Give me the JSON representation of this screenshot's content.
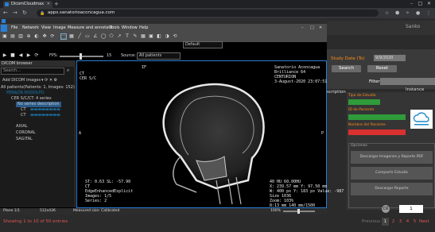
{
  "browser": {
    "tab_title": "DicomCloudmax",
    "url": "apps.sanatorioaconcagua.com"
  },
  "webpage": {
    "user": "Sanko",
    "study_date_label": "Study Date (To)",
    "study_date_value": "9/9/2020",
    "search_button": "Search",
    "reset_button": "Reset",
    "filter_label": "Filter:",
    "column_description": "scription",
    "column_instance": "Instance",
    "patient": {
      "tipo_estudio_label": "Tipo de Estudio",
      "id_paciente_label": "ID de Paciente",
      "nombre_label": "Nombre del Paciente"
    },
    "opciones_label": "Opciones",
    "options": [
      "Descargar Imagenes y Reporte PDF",
      "Compartir Estudio",
      "Descargar Reporte"
    ],
    "showing": "Showing 1 to 10 of 50 entries",
    "pager": {
      "prev": "Previous",
      "pages": [
        "1",
        "2",
        "3",
        "4",
        "5"
      ],
      "next": "Next"
    },
    "cr_badge": "CR",
    "page_number": "1"
  },
  "dicom": {
    "app_title": "DicomMax",
    "menu": [
      "File",
      "Network",
      "View",
      "Image",
      "Measure and annotate",
      "Tools",
      "Window",
      "Help"
    ],
    "layout_select": "Default",
    "fps_label": "FPS:",
    "fps_value": "15",
    "source_label": "Source:",
    "source_value": "All patients",
    "browser_title": "DICOM browser",
    "search_placeholder": "Search...",
    "add_images": "Add DICOM images",
    "tree": [
      "All patients(Patients: 1, Images: 152)",
      "PERALTA RODOLFO",
      "CER S/C/CT: 4 series",
      "No series description",
      "CT",
      "CT",
      "AXIAL",
      "CORONAL",
      "SAGITAL"
    ],
    "overlay": {
      "top_left": "CT\nCER S/C",
      "top_center": "IF",
      "top_right": "Sanatorio Aconcagua\nBrilliance 64\nCENTURION\n3-August-2020 23:07:51",
      "bottom_left": "ST: 0.63 SL: -57.90\nCT\nEdgeEnhancedExplicit\nImages: 1/5\nSeries: 2",
      "bottom_right": "40 HU 60.00HU\nX: 239.57 mm Y: 97.50 mm\nW: 400 px Y: 183 px Value: -987\nSize 1036\nZoom: 103%\n8:13 mm 140 mm/1500",
      "right_marker": "P",
      "left_marker": "A"
    },
    "status": {
      "plane": "Plane 1/1",
      "dims": "512x436",
      "measured": "Measured size: Calibrated",
      "zoom": "100%"
    }
  }
}
